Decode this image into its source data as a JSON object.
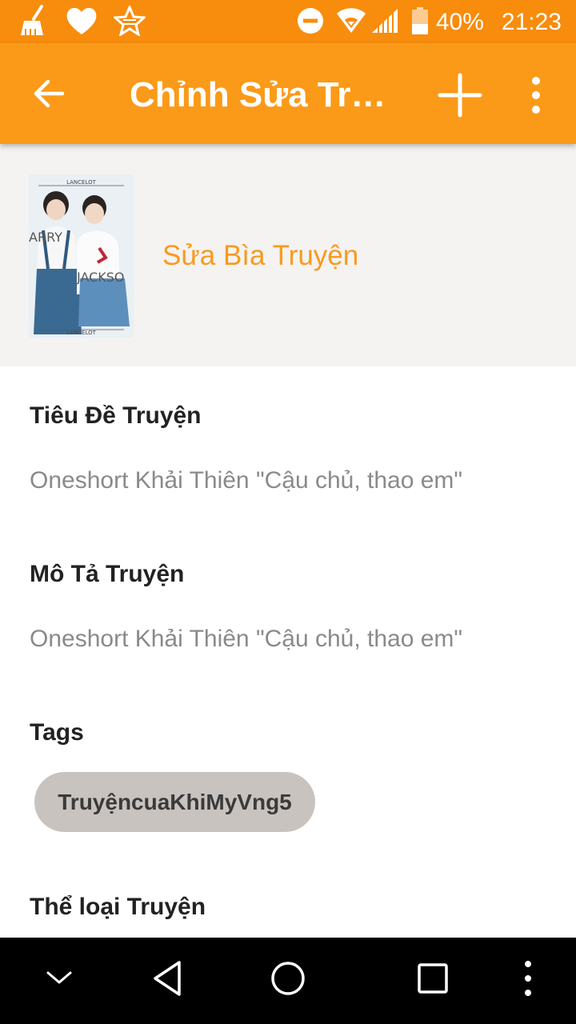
{
  "status_bar": {
    "battery_percent_label": "40%",
    "time": "21:23",
    "icons": [
      "broom-icon",
      "heart-icon",
      "star-badge-icon",
      "dnd-icon",
      "wifi-icon",
      "signal-icon",
      "battery-icon"
    ]
  },
  "app_bar": {
    "title": "Chỉnh Sửa Truyện",
    "icons": [
      "back-arrow-icon",
      "add-icon",
      "more-vert-icon"
    ]
  },
  "cover": {
    "edit_label": "Sửa Bìa Truyện",
    "image_text_top": "LANCELOT",
    "image_text_left": "ARRY",
    "image_text_right": "JACKSO",
    "image_text_bottom": "LANCELOT"
  },
  "fields": {
    "title_label": "Tiêu Đề Truyện",
    "title_value": "Oneshort Khải Thiên \"Cậu chủ, thao em\"",
    "description_label": "Mô Tả Truyện",
    "description_value": "Oneshort Khải Thiên \"Cậu chủ, thao em\"",
    "tags_label": "Tags",
    "tags": [
      "TruyệncuaKhiMyVng5"
    ],
    "genre_label": "Thể loại Truyện"
  },
  "nav_bar": {
    "icons": [
      "chevron-down-icon",
      "back-triangle-icon",
      "home-circle-icon",
      "recents-square-icon",
      "more-vert-icon"
    ]
  },
  "colors": {
    "status_bar": "#f88c0c",
    "app_bar": "#fb9a18",
    "accent_text": "#f89a20",
    "cover_bg": "#f4f3f1",
    "chip_bg": "#c8c3bf"
  }
}
